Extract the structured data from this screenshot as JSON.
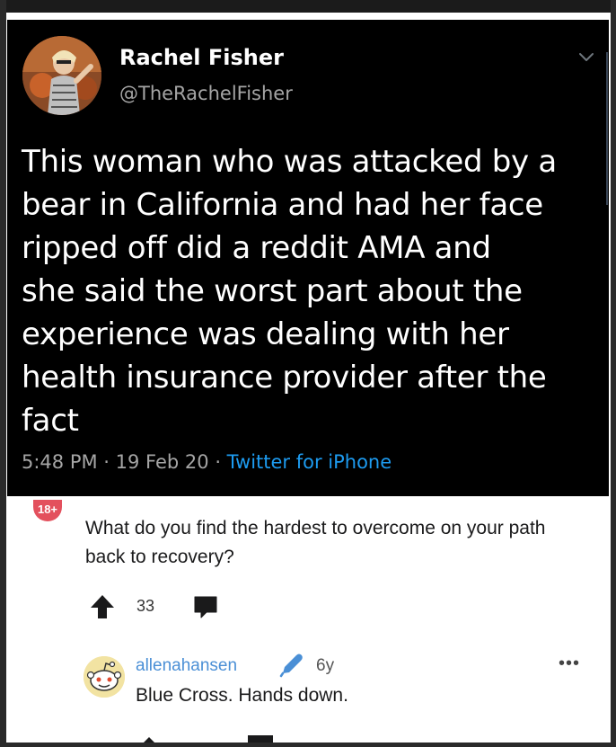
{
  "tweet": {
    "display_name": "Rachel Fisher",
    "handle": "@TheRachelFisher",
    "text_lines": [
      "This woman who was attacked by a",
      "bear in California and had her face",
      "ripped off did a reddit AMA and",
      "she said the worst part about the",
      "experience was dealing with her",
      "health insurance provider after the",
      "fact"
    ],
    "time": "5:48 PM",
    "date": "19 Feb 20",
    "separator": " · ",
    "source": "Twitter for iPhone",
    "icons": {
      "menu": "chevron-down-icon"
    }
  },
  "reddit": {
    "nsfw_badge": "18+",
    "question": "What do you find the hardest to overcome on your path back to recovery?",
    "votes": "33",
    "icons": {
      "upvote": "upvote-arrow-icon",
      "comment": "comment-icon",
      "flair": "pen-icon",
      "more": "more-icon"
    },
    "reply": {
      "username": "allenahansen",
      "age": "6y",
      "text": "Blue Cross. Hands down.",
      "more_label": "•••"
    }
  },
  "colors": {
    "tweet_bg": "#000000",
    "link_blue": "#1d9bf0",
    "reddit_username": "#4a8fd6",
    "nsfw_red": "#e3505d"
  }
}
